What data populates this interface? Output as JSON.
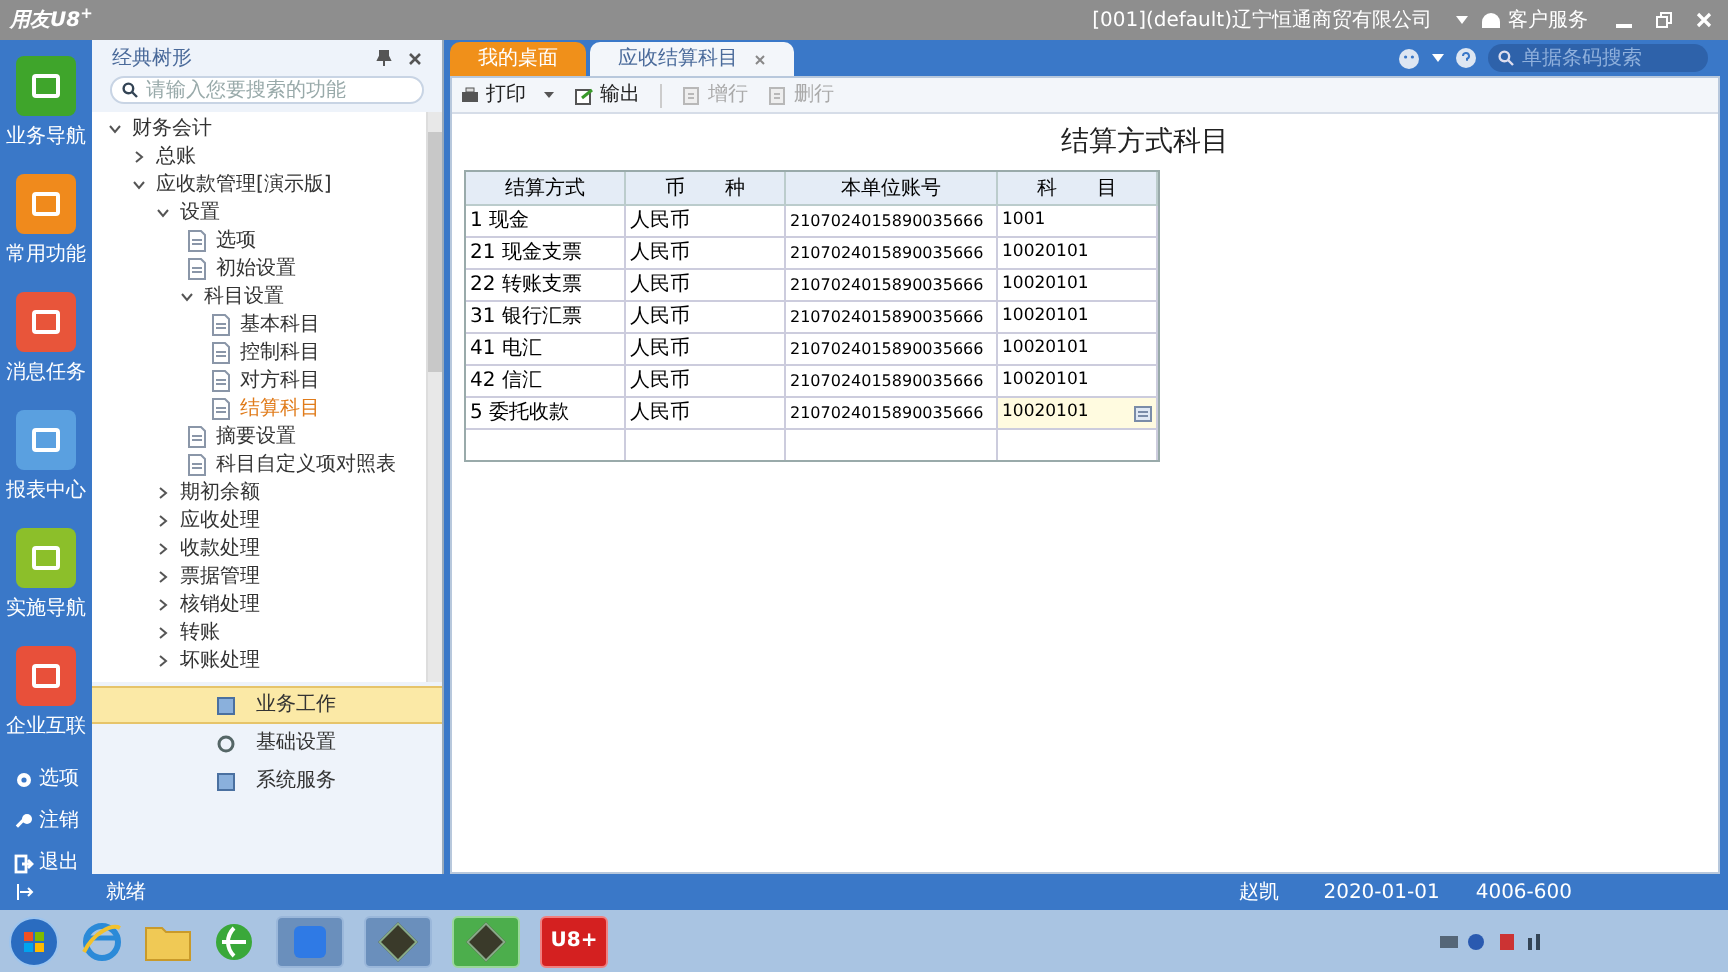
{
  "title_bar": {
    "logo": "用友U8",
    "logo_sup": "+",
    "company": "[001](default)辽宁恒通商贸有限公司",
    "service": "客户服务"
  },
  "nav": [
    {
      "label": "业务导航",
      "color": "#3fa52b"
    },
    {
      "label": "常用功能",
      "color": "#f08a1c"
    },
    {
      "label": "消息任务",
      "color": "#e8553a"
    },
    {
      "label": "报表中心",
      "color": "#5aa0e0"
    },
    {
      "label": "实施导航",
      "color": "#8cbf2a"
    },
    {
      "label": "企业互联",
      "color": "#e8503a"
    }
  ],
  "nav_bottom": [
    {
      "label": "选项",
      "kind": "gear"
    },
    {
      "label": "注销",
      "kind": "key"
    },
    {
      "label": "退出",
      "kind": "exit"
    }
  ],
  "tree_panel": {
    "title": "经典树形",
    "search_placeholder": "请输入您要搜索的功能",
    "tree": [
      {
        "label": "财务会计",
        "expanded": true,
        "children": [
          {
            "label": "总账",
            "expanded": false
          },
          {
            "label": "应收款管理[演示版]",
            "expanded": true,
            "children": [
              {
                "label": "设置",
                "expanded": true,
                "children": [
                  {
                    "label": "选项",
                    "selected": false
                  },
                  {
                    "label": "初始设置",
                    "selected": false
                  },
                  {
                    "label": "科目设置",
                    "expanded": true,
                    "children": [
                      {
                        "label": "基本科目",
                        "selected": false
                      },
                      {
                        "label": "控制科目",
                        "selected": false
                      },
                      {
                        "label": "对方科目",
                        "selected": false
                      },
                      {
                        "label": "结算科目",
                        "selected": true
                      }
                    ]
                  },
                  {
                    "label": "摘要设置",
                    "selected": false
                  },
                  {
                    "label": "科目自定义项对照表",
                    "selected": false
                  }
                ]
              },
              {
                "label": "期初余额",
                "expanded": false
              },
              {
                "label": "应收处理",
                "expanded": false
              },
              {
                "label": "收款处理",
                "expanded": false
              },
              {
                "label": "票据管理",
                "expanded": false
              },
              {
                "label": "核销处理",
                "expanded": false
              },
              {
                "label": "转账",
                "expanded": false
              },
              {
                "label": "坏账处理",
                "expanded": false
              }
            ]
          }
        ]
      }
    ],
    "sections": [
      {
        "label": "业务工作",
        "selected": true,
        "kind": "work"
      },
      {
        "label": "基础设置",
        "selected": false,
        "kind": "gear"
      },
      {
        "label": "系统服务",
        "selected": false,
        "kind": "service"
      }
    ]
  },
  "header": {
    "search_placeholder": "单据条码搜索"
  },
  "tabs": [
    {
      "label": "我的桌面",
      "selected": false,
      "closable": false
    },
    {
      "label": "应收结算科目",
      "selected": true,
      "closable": true
    }
  ],
  "toolbar": [
    {
      "label": "打印",
      "disabled": false,
      "dropdown": true,
      "kind": "print"
    },
    {
      "label": "输出",
      "disabled": false,
      "dropdown": false,
      "kind": "export"
    },
    {
      "label": "增行",
      "disabled": true,
      "dropdown": false,
      "kind": "add"
    },
    {
      "label": "删行",
      "disabled": true,
      "dropdown": false,
      "kind": "delete"
    }
  ],
  "page_title": "结算方式科目",
  "table": {
    "columns": [
      "结算方式",
      "币　　种",
      "本单位账号",
      "科　　目"
    ],
    "rows": [
      {
        "cells": [
          "1 现金",
          "人民币",
          "2107024015890035666",
          "1001"
        ],
        "editing": false
      },
      {
        "cells": [
          "21 现金支票",
          "人民币",
          "2107024015890035666",
          "10020101"
        ],
        "editing": false
      },
      {
        "cells": [
          "22 转账支票",
          "人民币",
          "2107024015890035666",
          "10020101"
        ],
        "editing": false
      },
      {
        "cells": [
          "31 银行汇票",
          "人民币",
          "2107024015890035666",
          "10020101"
        ],
        "editing": false
      },
      {
        "cells": [
          "41 电汇",
          "人民币",
          "2107024015890035666",
          "10020101"
        ],
        "editing": false
      },
      {
        "cells": [
          "42 信汇",
          "人民币",
          "2107024015890035666",
          "10020101"
        ],
        "editing": false
      },
      {
        "cells": [
          "5 委托收款",
          "人民币",
          "2107024015890035666",
          "10020101"
        ],
        "editing": true
      }
    ]
  },
  "status_bar": {
    "state": "就绪",
    "user": "赵凯",
    "date": "2020-01-01",
    "phone": "4006-600"
  },
  "taskbar": {
    "apps": [
      {
        "kind": "start"
      },
      {
        "kind": "ie"
      },
      {
        "kind": "folder"
      },
      {
        "kind": "browser"
      },
      {
        "kind": "wps"
      },
      {
        "kind": "app"
      },
      {
        "kind": "app-active"
      },
      {
        "kind": "u8",
        "label": "U8+"
      }
    ]
  }
}
